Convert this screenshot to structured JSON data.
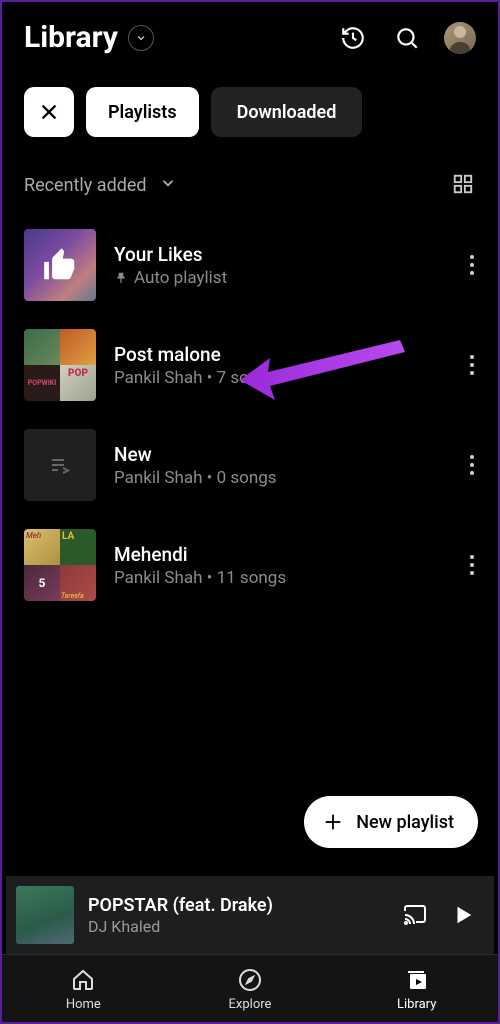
{
  "header": {
    "title": "Library"
  },
  "chips": {
    "playlists": "Playlists",
    "downloaded": "Downloaded"
  },
  "sort": {
    "label": "Recently added"
  },
  "playlists": [
    {
      "title": "Your Likes",
      "subtitle": "Auto playlist",
      "pinned": true,
      "thumb": "likes"
    },
    {
      "title": "Post malone",
      "subtitle": "Pankil Shah • 7 songs",
      "thumb": "collage1"
    },
    {
      "title": "New",
      "subtitle": "Pankil Shah • 0 songs",
      "thumb": "empty"
    },
    {
      "title": "Mehendi",
      "subtitle": "Pankil Shah • 11 songs",
      "thumb": "collage2"
    }
  ],
  "fab": {
    "label": "New playlist"
  },
  "mini_player": {
    "title": "POPSTAR (feat. Drake)",
    "artist": "DJ Khaled"
  },
  "nav": {
    "home": "Home",
    "explore": "Explore",
    "library": "Library"
  }
}
